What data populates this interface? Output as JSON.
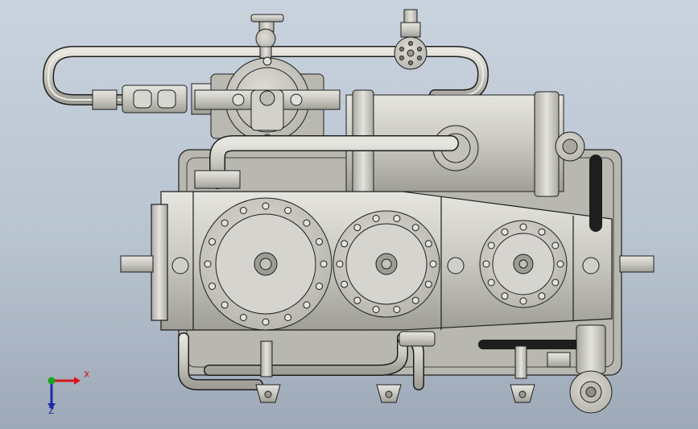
{
  "triad": {
    "x_label": "X",
    "z_label": "Z",
    "colors": {
      "x": "#d8141e",
      "y": "#19a51e",
      "z": "#1b2aa8"
    }
  },
  "colors": {
    "background_top": "#c9d3de",
    "background_bottom": "#9ea9b8",
    "metal": "#c9c8c1",
    "metal_light": "#e4e3dd",
    "metal_dark": "#8d8c86",
    "outline": "#1e1e1e"
  }
}
